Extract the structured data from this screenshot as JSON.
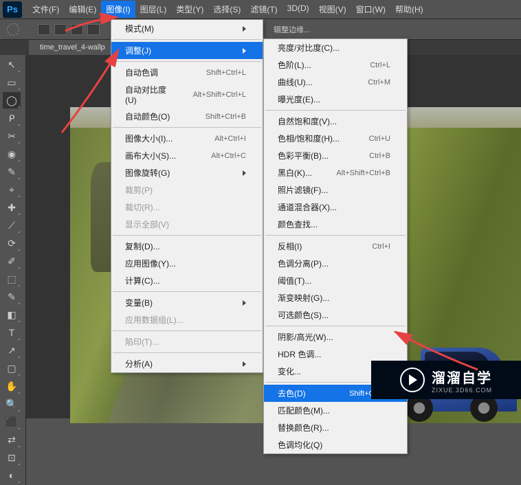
{
  "logo": "Ps",
  "menubar": [
    "文件(F)",
    "编辑(E)",
    "图像(I)",
    "图层(L)",
    "类型(Y)",
    "选择(S)",
    "滤镜(T)",
    "3D(D)",
    "视图(V)",
    "窗口(W)",
    "帮助(H)"
  ],
  "menubar_open_index": 2,
  "optbar_hint": "辑整边缘...",
  "doc_tab": "time_travel_4-wallp",
  "dd1": {
    "groups": [
      [
        {
          "label": "模式(M)",
          "arrow": true
        }
      ],
      [
        {
          "label": "调整(J)",
          "arrow": true,
          "hover": true
        }
      ],
      [
        {
          "label": "自动色调",
          "shortcut": "Shift+Ctrl+L"
        },
        {
          "label": "自动对比度(U)",
          "shortcut": "Alt+Shift+Ctrl+L"
        },
        {
          "label": "自动颜色(O)",
          "shortcut": "Shift+Ctrl+B"
        }
      ],
      [
        {
          "label": "图像大小(I)...",
          "shortcut": "Alt+Ctrl+I"
        },
        {
          "label": "画布大小(S)...",
          "shortcut": "Alt+Ctrl+C"
        },
        {
          "label": "图像旋转(G)",
          "arrow": true
        },
        {
          "label": "裁剪(P)",
          "disabled": true
        },
        {
          "label": "裁切(R)...",
          "disabled": true
        },
        {
          "label": "显示全部(V)",
          "disabled": true
        }
      ],
      [
        {
          "label": "复制(D)..."
        },
        {
          "label": "应用图像(Y)..."
        },
        {
          "label": "计算(C)..."
        }
      ],
      [
        {
          "label": "变量(B)",
          "arrow": true
        },
        {
          "label": "应用数据组(L)...",
          "disabled": true
        }
      ],
      [
        {
          "label": "陷印(T)...",
          "disabled": true
        }
      ],
      [
        {
          "label": "分析(A)",
          "arrow": true
        }
      ]
    ]
  },
  "dd2": {
    "groups": [
      [
        {
          "label": "亮度/对比度(C)..."
        },
        {
          "label": "色阶(L)...",
          "shortcut": "Ctrl+L"
        },
        {
          "label": "曲线(U)...",
          "shortcut": "Ctrl+M"
        },
        {
          "label": "曝光度(E)..."
        }
      ],
      [
        {
          "label": "自然饱和度(V)..."
        },
        {
          "label": "色相/饱和度(H)...",
          "shortcut": "Ctrl+U"
        },
        {
          "label": "色彩平衡(B)...",
          "shortcut": "Ctrl+B"
        },
        {
          "label": "黑白(K)...",
          "shortcut": "Alt+Shift+Ctrl+B"
        },
        {
          "label": "照片滤镜(F)..."
        },
        {
          "label": "通道混合器(X)..."
        },
        {
          "label": "颜色查找..."
        }
      ],
      [
        {
          "label": "反相(I)",
          "shortcut": "Ctrl+I"
        },
        {
          "label": "色调分离(P)..."
        },
        {
          "label": "阈值(T)..."
        },
        {
          "label": "渐变映射(G)..."
        },
        {
          "label": "可选颜色(S)..."
        }
      ],
      [
        {
          "label": "阴影/高光(W)..."
        },
        {
          "label": "HDR 色调..."
        },
        {
          "label": "变化..."
        }
      ],
      [
        {
          "label": "去色(D)",
          "shortcut": "Shift+Ctrl+U",
          "hover": true
        },
        {
          "label": "匹配颜色(M)..."
        },
        {
          "label": "替换颜色(R)..."
        },
        {
          "label": "色调均化(Q)"
        }
      ]
    ]
  },
  "watermark": {
    "main": "溜溜自学",
    "sub": "ZIXUE.3D66.COM"
  },
  "chart_data": null
}
